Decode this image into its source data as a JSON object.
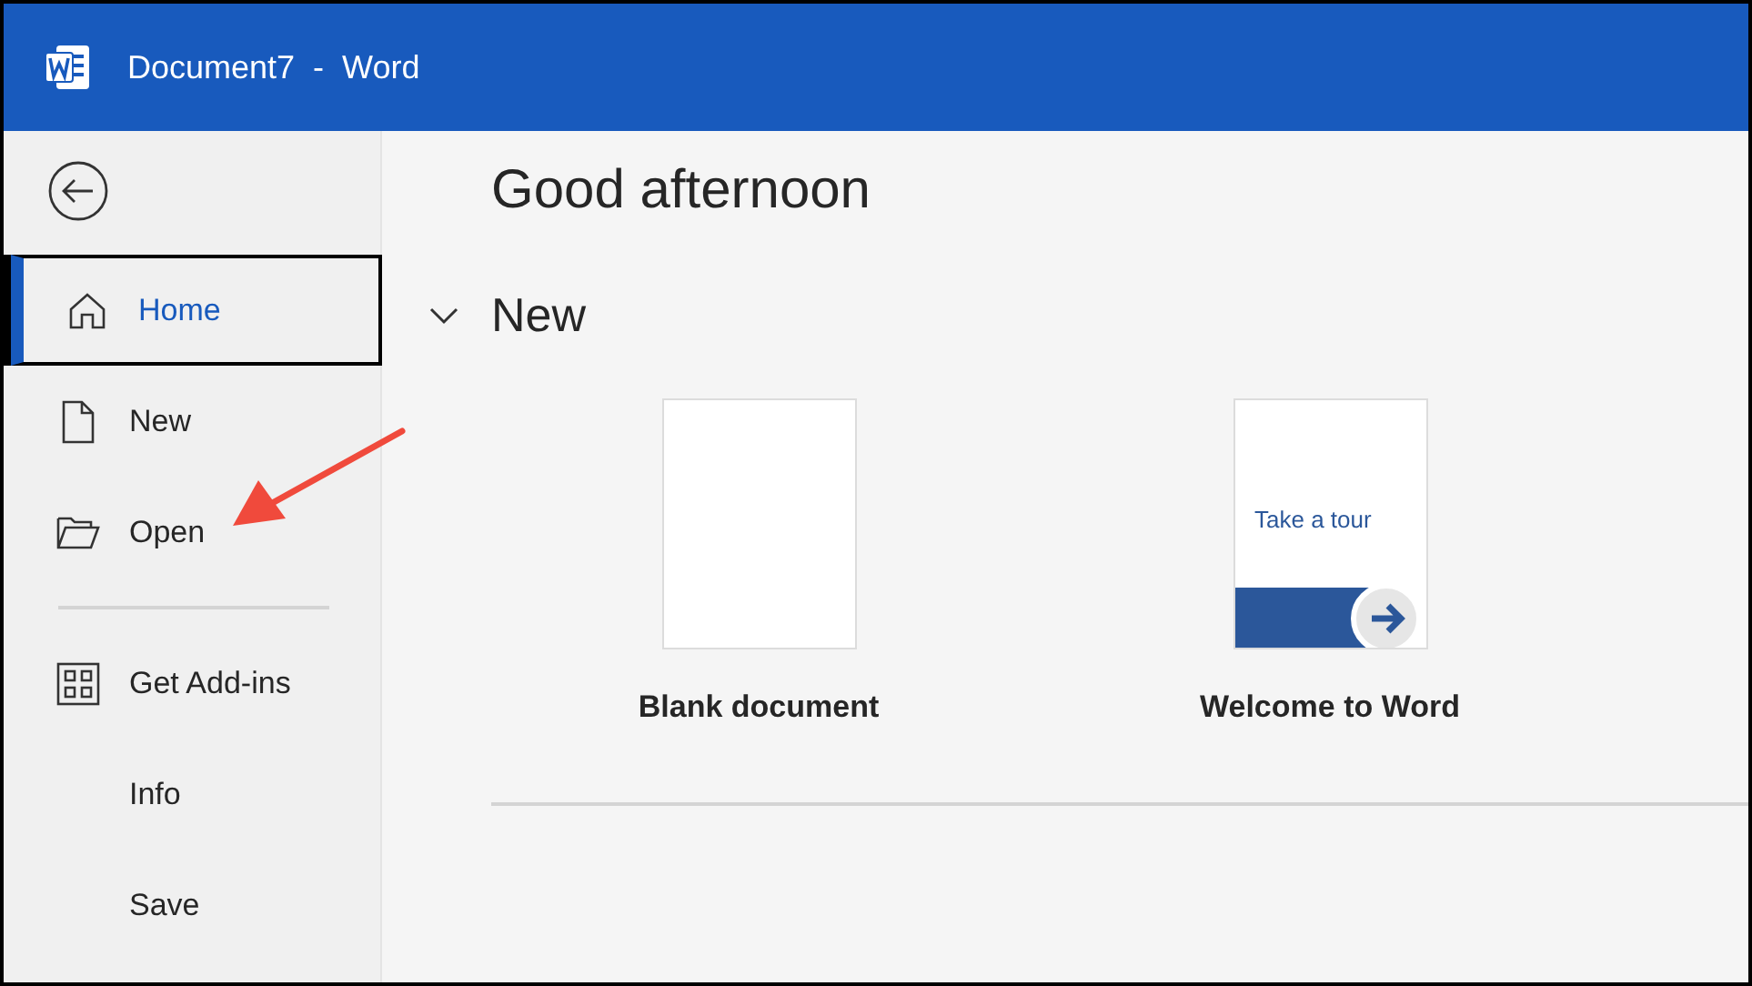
{
  "window": {
    "document": "Document7",
    "separator": "-",
    "app": "Word"
  },
  "sidebar": {
    "groups": [
      [
        {
          "label": "Home",
          "selected": true
        },
        {
          "label": "New",
          "selected": false
        },
        {
          "label": "Open",
          "selected": false
        }
      ],
      [
        {
          "label": "Get Add-ins",
          "selected": false
        },
        {
          "label": "Info",
          "selected": false
        },
        {
          "label": "Save",
          "selected": false
        }
      ]
    ]
  },
  "greeting": "Good afternoon",
  "new_section": {
    "title": "New",
    "expanded": true,
    "templates": [
      {
        "kind": "blank",
        "title": "Blank document"
      },
      {
        "kind": "tour",
        "title": "Welcome to Word",
        "preview_text": "Take a tour"
      }
    ]
  }
}
